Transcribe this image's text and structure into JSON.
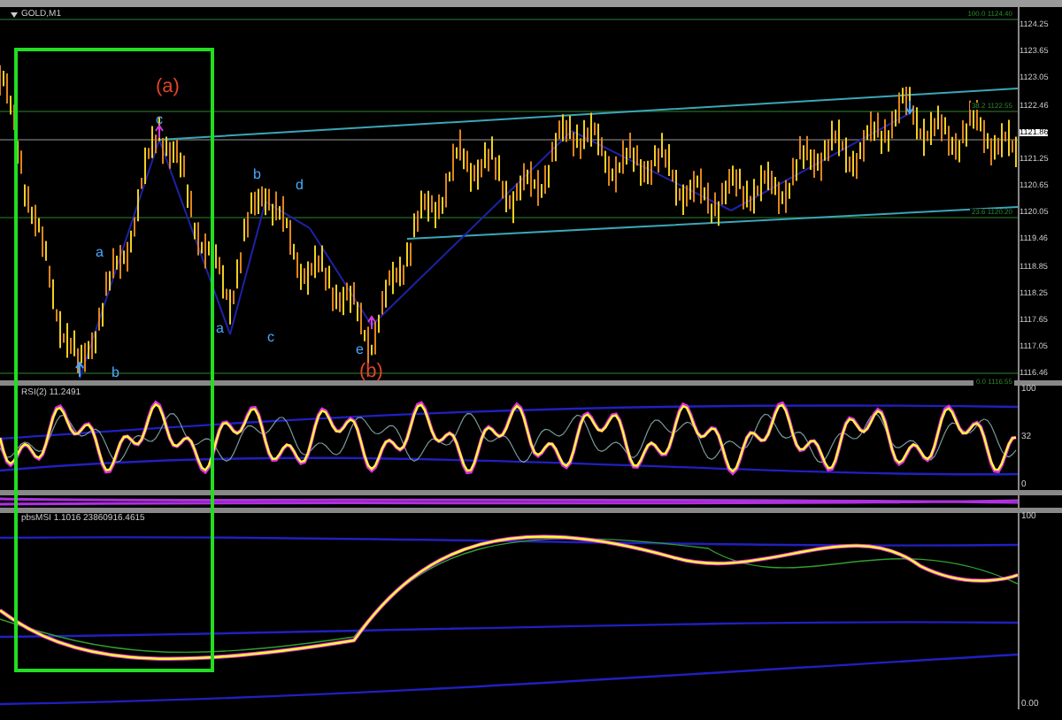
{
  "chart": {
    "symbol": "GOLD,M1",
    "price_axis": [
      {
        "text": "1124.25",
        "highlighted": false
      },
      {
        "text": "1123.65",
        "highlighted": false
      },
      {
        "text": "1123.05",
        "highlighted": false
      },
      {
        "text": "1122.46",
        "highlighted": false
      },
      {
        "text": "1121.86",
        "highlighted": true
      },
      {
        "text": "1121.25",
        "highlighted": false
      },
      {
        "text": "1120.65",
        "highlighted": false
      },
      {
        "text": "1120.05",
        "highlighted": false
      },
      {
        "text": "1119.46",
        "highlighted": false
      },
      {
        "text": "1118.85",
        "highlighted": false
      },
      {
        "text": "1118.25",
        "highlighted": false
      },
      {
        "text": "1117.65",
        "highlighted": false
      },
      {
        "text": "1117.05",
        "highlighted": false
      },
      {
        "text": "1116.46",
        "highlighted": false
      }
    ],
    "fibo_levels": [
      "100.0 1124.40",
      "38.2 1122.55",
      "23.6 1120.20",
      "0.0 1116.55"
    ],
    "wave_labels": [
      {
        "text": "(a)",
        "kind": "major"
      },
      {
        "text": "c",
        "kind": "minor"
      },
      {
        "text": "a",
        "kind": "minor"
      },
      {
        "text": "b",
        "kind": "minor"
      },
      {
        "text": "b",
        "kind": "minor"
      },
      {
        "text": "d",
        "kind": "minor"
      },
      {
        "text": "a",
        "kind": "minor"
      },
      {
        "text": "c",
        "kind": "minor"
      },
      {
        "text": "e",
        "kind": "minor"
      },
      {
        "text": "(b)",
        "kind": "major"
      }
    ]
  },
  "indicator_1": {
    "title": "RSI(2) 11.2491",
    "axis": [
      "100",
      "32",
      "0"
    ]
  },
  "indicator_2": {
    "title": "pbsMSI 1.1016 23860916.4615",
    "axis": [
      "100",
      "0.00"
    ]
  }
}
